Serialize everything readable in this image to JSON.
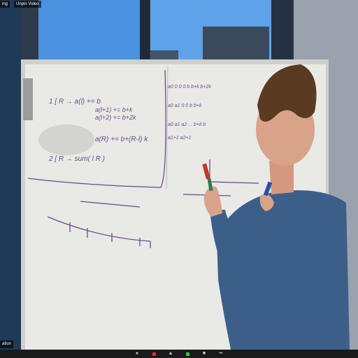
{
  "window": {
    "top_chips": [
      "ing",
      "Unpin Video"
    ],
    "name_tag": "ation"
  },
  "whiteboard": {
    "left_lines": [
      "1  [  R  →  a(l)  +=  b",
      "a(l+1) += b+k",
      "a(l+2) += b+2k",
      "a(R) += b+(R-l) k",
      "2  [  R  →  sum( l  R )"
    ],
    "right_lines": [
      "a0  0  0  0  b  b+k  b+2k",
      "a0 a1 0  0  b  b+k",
      "a0 a1 a2 ... b+k  b",
      "a1+1 a2+1"
    ]
  },
  "toolbar": {
    "buttons": [
      "mic",
      "video",
      "participants",
      "chat",
      "share",
      "more"
    ]
  },
  "colors": {
    "wall": "#2d3a4a",
    "board": "#e9e9e6",
    "shirt": "#3c5f8a",
    "skin": "#d9a38a",
    "hair": "#5a3a22",
    "marker_red": "#c0392b",
    "marker_blue": "#2b4fae",
    "marker_green": "#2e7d4f"
  }
}
